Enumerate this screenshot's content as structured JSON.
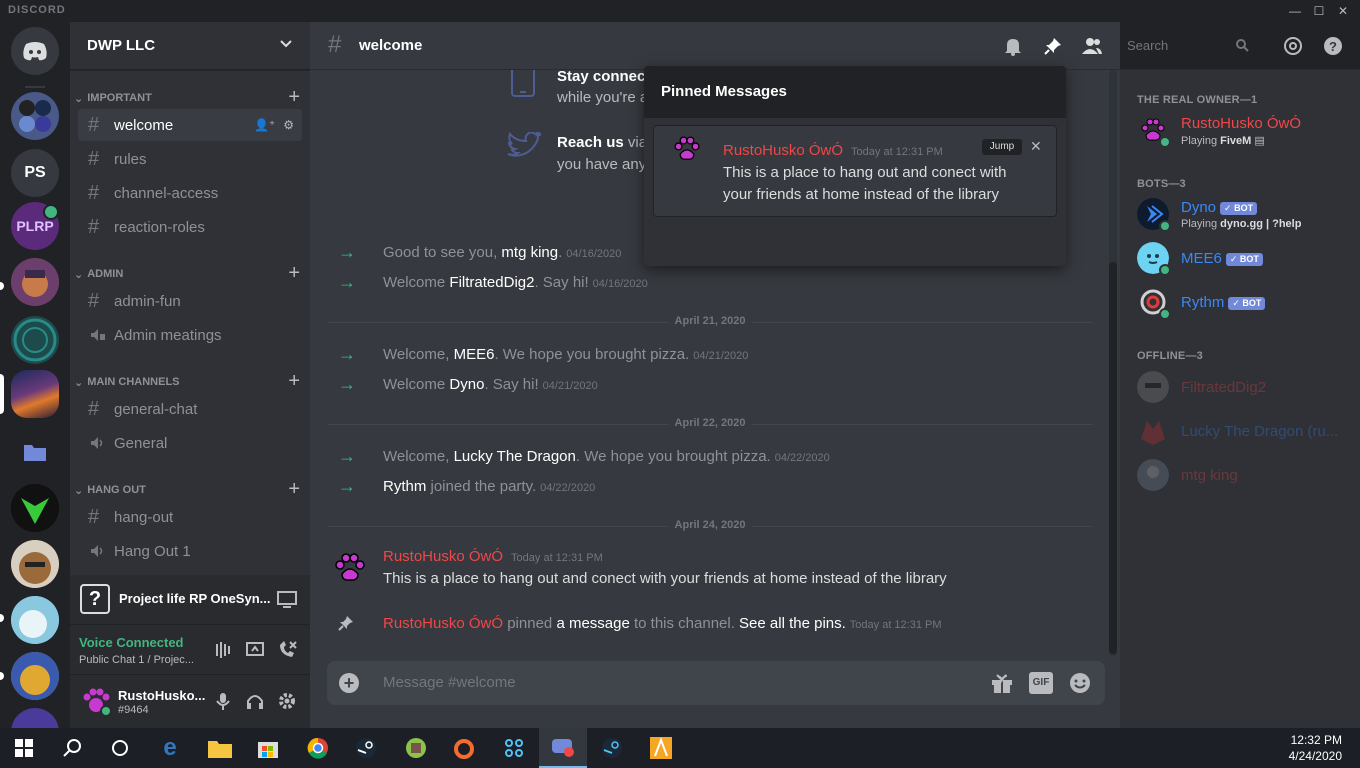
{
  "app": {
    "brand": "DISCORD"
  },
  "guild": {
    "name": "DWP LLC",
    "dm_initials": "PS"
  },
  "categories": [
    {
      "label": "IMPORTANT",
      "channels": [
        {
          "name": "welcome",
          "type": "text",
          "active": true
        },
        {
          "name": "rules",
          "type": "text"
        },
        {
          "name": "channel-access",
          "type": "text"
        },
        {
          "name": "reaction-roles",
          "type": "text"
        }
      ]
    },
    {
      "label": "ADMIN",
      "channels": [
        {
          "name": "admin-fun",
          "type": "text-locked"
        },
        {
          "name": "Admin meatings",
          "type": "voice-locked"
        }
      ]
    },
    {
      "label": "MAIN CHANNELS",
      "channels": [
        {
          "name": "general-chat",
          "type": "text"
        },
        {
          "name": "General",
          "type": "voice"
        }
      ]
    },
    {
      "label": "HANG OUT",
      "channels": [
        {
          "name": "hang-out",
          "type": "text"
        },
        {
          "name": "Hang Out 1",
          "type": "voice"
        }
      ]
    }
  ],
  "activity": {
    "name": "Project life RP OneSyn..."
  },
  "voice": {
    "status": "Voice Connected",
    "sub": "Public Chat 1 / Projec..."
  },
  "user": {
    "name": "RustoHusko...",
    "tag": "#9464"
  },
  "channel_header": {
    "name": "welcome",
    "search_placeholder": "Search"
  },
  "welcome_lines": {
    "stay_bold": "Stay connect",
    "stay_rest": "while you're a",
    "reach_bold": "Reach us",
    "reach_after": " via",
    "reach_rest": "you have any"
  },
  "messages": {
    "sys1": {
      "pre": "Good to see you, ",
      "name": "mtg king",
      "post": ".",
      "ts": "04/16/2020"
    },
    "sys2": {
      "pre": "Welcome ",
      "name": "FiltratedDig2",
      "post": ". Say hi!",
      "ts": "04/16/2020"
    },
    "div1": "April 21, 2020",
    "sys3": {
      "pre": "Welcome, ",
      "name": "MEE6",
      "post": ". We hope you brought pizza.",
      "ts": "04/21/2020"
    },
    "sys4": {
      "pre": "Welcome ",
      "name": "Dyno",
      "post": ". Say hi!",
      "ts": "04/21/2020"
    },
    "div2": "April 22, 2020",
    "sys5": {
      "pre": "Welcome, ",
      "name": "Lucky The Dragon",
      "post": ". We hope you brought pizza.",
      "ts": "04/22/2020"
    },
    "sys6": {
      "pre": "",
      "name": "Rythm",
      "post": " joined the party.",
      "ts": "04/22/2020"
    },
    "div3": "April 24, 2020",
    "msg1": {
      "author": "RustoHusko ÓwÓ",
      "ts": "Today at 12:31 PM",
      "body": "This is a place to hang out and conect with your friends at home instead of the library"
    },
    "pin": {
      "author": "RustoHusko ÓwÓ",
      "mid": " pinned ",
      "link": "a message",
      "mid2": " to this channel. ",
      "see": "See all the pins.",
      "ts": "Today at 12:31 PM"
    }
  },
  "composer": {
    "placeholder": "Message #welcome",
    "gif": "GIF"
  },
  "pinned": {
    "title": "Pinned Messages",
    "author": "RustoHusko ÓwÓ",
    "ts": "Today at 12:31 PM",
    "jump": "Jump",
    "body": "This is a place to hang out and conect with your friends at home instead of the library"
  },
  "members": {
    "owner_cat": "THE REAL OWNER—1",
    "owner": {
      "name": "RustoHusko ÓwÓ",
      "act_pre": "Playing ",
      "act": "FiveM"
    },
    "bots_cat": "BOTS—3",
    "bots": [
      {
        "name": "Dyno",
        "badge": "✓ BOT",
        "act_pre": "Playing ",
        "act": "dyno.gg | ?help",
        "color": "#3b88f5"
      },
      {
        "name": "MEE6",
        "badge": "✓ BOT",
        "color": "#3b88f5"
      },
      {
        "name": "Rythm",
        "badge": "✓ BOT",
        "color": "#3b88f5"
      }
    ],
    "offline_cat": "OFFLINE—3",
    "offline": [
      {
        "name": "FiltratedDig2",
        "color": "#f04747"
      },
      {
        "name": "Lucky The Dragon (ru...",
        "color": "#3b88f5"
      },
      {
        "name": "mtg king",
        "color": "#f04747"
      }
    ]
  },
  "taskbar": {
    "time": "12:32 PM",
    "date": "4/24/2020"
  },
  "colors": {
    "accent": "#7289da",
    "online": "#43b581",
    "owner_red": "#f04747",
    "bot_blue": "#3b88f5"
  }
}
